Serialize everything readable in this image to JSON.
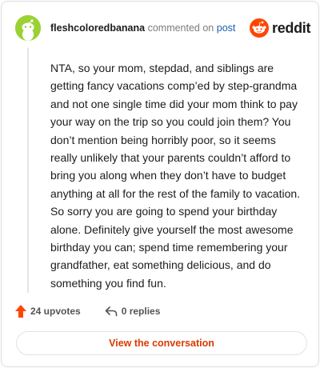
{
  "header": {
    "username": "fleshcoloredbanana",
    "action_text": "commented on",
    "post_link": "post",
    "brand": "reddit"
  },
  "comment": {
    "body": "NTA, so your mom, stepdad, and siblings are getting fancy vacations comp’ed by step-grandma and not one single time did your mom think to pay your way on the trip so you could join them? You don’t mention being horribly poor, so it seems really unlikely that your parents couldn’t afford to bring you along when they don’t have to budget anything at all for the rest of the family to vacation. So sorry you are going to spend your birthday alone. Definitely give yourself the most awesome birthday you can; spend time remembering your grandfather, eat something delicious, and do something you find fun."
  },
  "actions": {
    "upvotes": "24 upvotes",
    "replies": "0 replies"
  },
  "cta": {
    "label": "View the conversation"
  },
  "colors": {
    "accent": "#d93a00",
    "reddit_orange": "#ff4500",
    "upvote": "#ff4500",
    "avatar_bg": "#9bd233",
    "link": "#1a5fb4"
  },
  "icons": [
    "avatar-icon",
    "reddit-logo-icon",
    "upvote-icon",
    "reply-icon"
  ]
}
